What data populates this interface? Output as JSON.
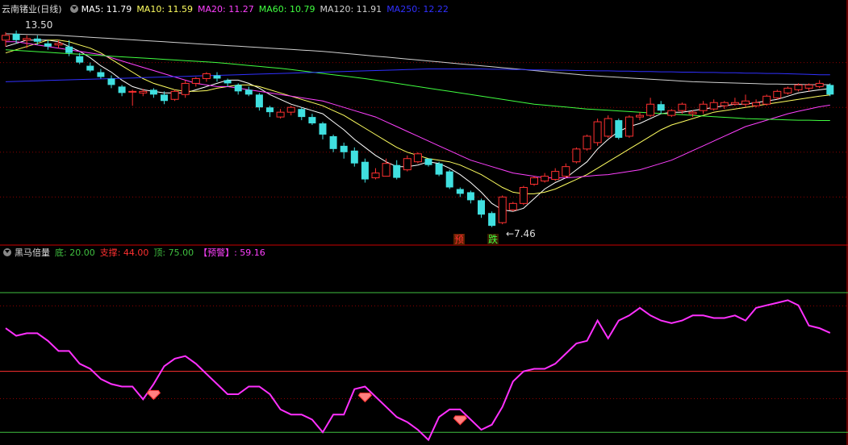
{
  "top_header": {
    "title": "云南锗业(日线)",
    "items": [
      {
        "label": "MA5: 11.79",
        "color": "#ffffff"
      },
      {
        "label": "MA10: 11.59",
        "color": "#ffff60"
      },
      {
        "label": "MA20: 11.27",
        "color": "#ff40ff"
      },
      {
        "label": "MA60: 10.79",
        "color": "#40ff40"
      },
      {
        "label": "MA120: 11.91",
        "color": "#d0d0d0"
      },
      {
        "label": "MA250: 12.22",
        "color": "#3030ff"
      }
    ]
  },
  "bottom_header": {
    "title": "黑马倍量",
    "items": [
      {
        "label": "底: 20.00",
        "color": "#40c040"
      },
      {
        "label": "支撑: 44.00",
        "color": "#ff3030"
      },
      {
        "label": "顶: 75.00",
        "color": "#40c040"
      },
      {
        "label": "【预警】: 59.16",
        "color": "#ff40ff"
      }
    ]
  },
  "annotations": {
    "high_label": "13.50",
    "low_label": "←7.46",
    "signal_pre": "预",
    "signal_drop": "跌"
  },
  "colors": {
    "up": "#ff3030",
    "down": "#40e0e0",
    "grid": "#8b0000",
    "separator": "#cc0000",
    "indicator": "#ff30ff"
  },
  "chart_data": [
    {
      "type": "candlestick",
      "title": "云南锗业(日线)",
      "ylim": [
        7.0,
        14.0
      ],
      "candles": [
        [
          13.3,
          13.55,
          13.1,
          13.45
        ],
        [
          13.5,
          13.6,
          13.2,
          13.3
        ],
        [
          13.3,
          13.45,
          13.05,
          13.35
        ],
        [
          13.35,
          13.45,
          13.15,
          13.25
        ],
        [
          13.2,
          13.3,
          13.0,
          13.1
        ],
        [
          13.15,
          13.3,
          13.05,
          13.2
        ],
        [
          13.1,
          13.3,
          12.8,
          12.9
        ],
        [
          12.8,
          12.9,
          12.55,
          12.6
        ],
        [
          12.5,
          12.6,
          12.3,
          12.35
        ],
        [
          12.3,
          12.4,
          12.1,
          12.15
        ],
        [
          12.1,
          12.2,
          11.8,
          11.9
        ],
        [
          11.85,
          11.9,
          11.55,
          11.65
        ],
        [
          11.7,
          11.75,
          11.25,
          11.7
        ],
        [
          11.65,
          11.78,
          11.55,
          11.7
        ],
        [
          11.75,
          11.8,
          11.5,
          11.6
        ],
        [
          11.6,
          11.7,
          11.3,
          11.4
        ],
        [
          11.45,
          11.75,
          11.4,
          11.7
        ],
        [
          11.6,
          12.05,
          11.5,
          11.95
        ],
        [
          11.95,
          12.15,
          11.85,
          12.1
        ],
        [
          12.1,
          12.3,
          12.0,
          12.25
        ],
        [
          12.2,
          12.3,
          12.0,
          12.1
        ],
        [
          12.05,
          12.1,
          11.85,
          11.95
        ],
        [
          11.9,
          11.95,
          11.6,
          11.7
        ],
        [
          11.75,
          11.85,
          11.55,
          11.6
        ],
        [
          11.6,
          11.65,
          11.1,
          11.2
        ],
        [
          11.2,
          11.25,
          10.9,
          11.05
        ],
        [
          10.9,
          11.15,
          10.85,
          11.05
        ],
        [
          11.05,
          11.25,
          10.95,
          11.2
        ],
        [
          11.15,
          11.2,
          10.8,
          10.9
        ],
        [
          10.9,
          11.0,
          10.65,
          10.7
        ],
        [
          10.7,
          10.75,
          10.2,
          10.35
        ],
        [
          10.3,
          10.35,
          9.8,
          9.9
        ],
        [
          10.0,
          10.1,
          9.6,
          9.8
        ],
        [
          9.85,
          9.95,
          9.35,
          9.45
        ],
        [
          9.5,
          9.6,
          8.85,
          8.95
        ],
        [
          9.0,
          9.3,
          8.95,
          9.15
        ],
        [
          9.05,
          9.6,
          9.05,
          9.45
        ],
        [
          9.4,
          9.55,
          8.95,
          9.0
        ],
        [
          9.25,
          9.7,
          9.2,
          9.6
        ],
        [
          9.5,
          9.8,
          9.45,
          9.75
        ],
        [
          9.6,
          9.6,
          9.35,
          9.4
        ],
        [
          9.45,
          9.5,
          9.05,
          9.1
        ],
        [
          9.2,
          9.25,
          8.65,
          8.7
        ],
        [
          8.65,
          8.7,
          8.4,
          8.5
        ],
        [
          8.55,
          8.6,
          8.2,
          8.3
        ],
        [
          8.3,
          8.35,
          7.75,
          7.85
        ],
        [
          7.9,
          7.95,
          7.46,
          7.5
        ],
        [
          7.6,
          8.45,
          7.55,
          8.4
        ],
        [
          8.0,
          8.25,
          7.95,
          8.2
        ],
        [
          8.2,
          8.75,
          8.15,
          8.7
        ],
        [
          8.8,
          9.05,
          8.75,
          9.0
        ],
        [
          8.9,
          9.15,
          8.85,
          9.05
        ],
        [
          8.95,
          9.3,
          8.9,
          9.2
        ],
        [
          9.05,
          9.45,
          9.0,
          9.35
        ],
        [
          9.5,
          9.95,
          9.45,
          9.9
        ],
        [
          9.9,
          10.35,
          9.85,
          10.3
        ],
        [
          10.1,
          10.85,
          10.0,
          10.75
        ],
        [
          10.3,
          10.95,
          10.25,
          10.85
        ],
        [
          10.8,
          10.85,
          10.2,
          10.25
        ],
        [
          10.3,
          10.95,
          10.25,
          10.9
        ],
        [
          10.9,
          11.05,
          10.8,
          10.95
        ],
        [
          10.95,
          11.5,
          10.9,
          11.3
        ],
        [
          11.3,
          11.4,
          11.0,
          11.1
        ],
        [
          10.95,
          11.15,
          10.9,
          11.1
        ],
        [
          11.1,
          11.35,
          11.0,
          11.3
        ],
        [
          11.0,
          11.1,
          10.9,
          11.05
        ],
        [
          11.1,
          11.4,
          11.0,
          11.3
        ],
        [
          11.15,
          11.45,
          11.1,
          11.35
        ],
        [
          11.25,
          11.4,
          11.15,
          11.35
        ],
        [
          11.3,
          11.5,
          11.25,
          11.35
        ],
        [
          11.3,
          11.6,
          11.2,
          11.4
        ],
        [
          11.25,
          11.45,
          11.2,
          11.35
        ],
        [
          11.3,
          11.6,
          11.25,
          11.55
        ],
        [
          11.5,
          11.75,
          11.45,
          11.7
        ],
        [
          11.65,
          11.85,
          11.6,
          11.8
        ],
        [
          11.75,
          11.95,
          11.7,
          11.9
        ],
        [
          11.8,
          11.95,
          11.7,
          11.9
        ],
        [
          11.85,
          12.05,
          11.8,
          11.95
        ],
        [
          11.9,
          11.95,
          11.55,
          11.6
        ]
      ],
      "series": [
        {
          "name": "MA5",
          "values": [
            13.1,
            13.2,
            13.3,
            13.3,
            13.3,
            13.25,
            13.1,
            12.95,
            12.75,
            12.5,
            12.3,
            12.05,
            11.85,
            11.75,
            11.7,
            11.65,
            11.65,
            11.65,
            11.75,
            11.85,
            11.95,
            12.05,
            12.05,
            11.95,
            11.8,
            11.6,
            11.45,
            11.3,
            11.2,
            11.1,
            11.0,
            10.75,
            10.5,
            10.2,
            9.95,
            9.7,
            9.5,
            9.35,
            9.35,
            9.4,
            9.5,
            9.45,
            9.3,
            9.1,
            8.85,
            8.55,
            8.2,
            8.0,
            7.95,
            8.05,
            8.35,
            8.65,
            8.85,
            9.0,
            9.25,
            9.5,
            9.9,
            10.2,
            10.45,
            10.6,
            10.7,
            10.85,
            11.0,
            11.05,
            11.05,
            11.1,
            11.15,
            11.2,
            11.25,
            11.3,
            11.3,
            11.35,
            11.4,
            11.45,
            11.55,
            11.65,
            11.7,
            11.75,
            11.79
          ]
        },
        {
          "name": "MA10",
          "values": [
            12.9,
            13.0,
            13.1,
            13.2,
            13.3,
            13.3,
            13.25,
            13.15,
            13.05,
            12.9,
            12.7,
            12.5,
            12.3,
            12.1,
            11.95,
            11.85,
            11.75,
            11.7,
            11.7,
            11.72,
            11.8,
            11.85,
            11.9,
            11.9,
            11.85,
            11.75,
            11.65,
            11.55,
            11.45,
            11.35,
            11.25,
            11.1,
            10.95,
            10.75,
            10.55,
            10.35,
            10.15,
            9.95,
            9.8,
            9.7,
            9.6,
            9.55,
            9.5,
            9.4,
            9.25,
            9.1,
            8.9,
            8.7,
            8.55,
            8.5,
            8.5,
            8.55,
            8.65,
            8.8,
            8.95,
            9.1,
            9.3,
            9.5,
            9.7,
            9.9,
            10.1,
            10.3,
            10.5,
            10.65,
            10.75,
            10.85,
            10.95,
            11.05,
            11.1,
            11.15,
            11.2,
            11.25,
            11.3,
            11.35,
            11.4,
            11.45,
            11.5,
            11.55,
            11.59
          ]
        },
        {
          "name": "MA20",
          "values": [
            13.25,
            13.25,
            13.2,
            13.15,
            13.1,
            13.05,
            13.0,
            12.95,
            12.9,
            12.85,
            12.75,
            12.65,
            12.55,
            12.45,
            12.35,
            12.25,
            12.15,
            12.05,
            11.95,
            11.9,
            11.85,
            11.85,
            11.8,
            11.75,
            11.7,
            11.65,
            11.6,
            11.55,
            11.5,
            11.45,
            11.4,
            11.3,
            11.2,
            11.1,
            11.0,
            10.9,
            10.75,
            10.6,
            10.45,
            10.3,
            10.15,
            10.0,
            9.85,
            9.7,
            9.55,
            9.45,
            9.35,
            9.25,
            9.15,
            9.1,
            9.05,
            9.0,
            9.0,
            9.0,
            9.02,
            9.05,
            9.08,
            9.1,
            9.15,
            9.2,
            9.25,
            9.35,
            9.45,
            9.55,
            9.7,
            9.85,
            10.0,
            10.15,
            10.3,
            10.45,
            10.6,
            10.7,
            10.8,
            10.9,
            11.0,
            11.08,
            11.15,
            11.22,
            11.27
          ]
        },
        {
          "name": "MA60",
          "values": [
            13.0,
            12.98,
            12.96,
            12.94,
            12.92,
            12.9,
            12.88,
            12.86,
            12.84,
            12.82,
            12.8,
            12.78,
            12.76,
            12.74,
            12.72,
            12.7,
            12.68,
            12.66,
            12.64,
            12.62,
            12.6,
            12.57,
            12.54,
            12.51,
            12.48,
            12.45,
            12.42,
            12.38,
            12.34,
            12.3,
            12.26,
            12.22,
            12.18,
            12.14,
            12.1,
            12.05,
            12.0,
            11.95,
            11.9,
            11.85,
            11.8,
            11.75,
            11.7,
            11.65,
            11.6,
            11.55,
            11.5,
            11.45,
            11.4,
            11.35,
            11.3,
            11.27,
            11.24,
            11.21,
            11.18,
            11.15,
            11.13,
            11.11,
            11.09,
            11.07,
            11.05,
            11.03,
            11.01,
            10.99,
            10.97,
            10.95,
            10.93,
            10.91,
            10.89,
            10.87,
            10.85,
            10.84,
            10.83,
            10.82,
            10.81,
            10.8,
            10.8,
            10.79,
            10.79
          ]
        },
        {
          "name": "MA120",
          "values": [
            13.5,
            13.49,
            13.48,
            13.47,
            13.46,
            13.45,
            13.43,
            13.41,
            13.39,
            13.37,
            13.35,
            13.33,
            13.31,
            13.29,
            13.27,
            13.25,
            13.23,
            13.21,
            13.19,
            13.17,
            13.15,
            13.13,
            13.11,
            13.09,
            13.07,
            13.05,
            13.03,
            13.01,
            12.99,
            12.97,
            12.95,
            12.92,
            12.89,
            12.86,
            12.83,
            12.8,
            12.77,
            12.74,
            12.71,
            12.68,
            12.65,
            12.62,
            12.59,
            12.56,
            12.53,
            12.5,
            12.47,
            12.44,
            12.41,
            12.38,
            12.35,
            12.32,
            12.29,
            12.26,
            12.23,
            12.2,
            12.18,
            12.16,
            12.14,
            12.12,
            12.1,
            12.08,
            12.06,
            12.04,
            12.02,
            12.0,
            11.99,
            11.98,
            11.97,
            11.96,
            11.95,
            11.94,
            11.93,
            11.93,
            11.92,
            11.92,
            11.91,
            11.91,
            11.91
          ]
        },
        {
          "name": "MA250",
          "values": [
            12.0,
            12.01,
            12.02,
            12.03,
            12.04,
            12.05,
            12.06,
            12.07,
            12.08,
            12.09,
            12.1,
            12.11,
            12.12,
            12.13,
            12.14,
            12.15,
            12.16,
            12.17,
            12.18,
            12.19,
            12.2,
            12.21,
            12.22,
            12.23,
            12.24,
            12.25,
            12.26,
            12.27,
            12.28,
            12.29,
            12.3,
            12.31,
            12.32,
            12.33,
            12.34,
            12.35,
            12.36,
            12.37,
            12.38,
            12.39,
            12.4,
            12.4,
            12.4,
            12.4,
            12.4,
            12.4,
            12.39,
            12.39,
            12.38,
            12.38,
            12.37,
            12.37,
            12.36,
            12.36,
            12.35,
            12.35,
            12.34,
            12.34,
            12.33,
            12.33,
            12.32,
            12.32,
            12.31,
            12.31,
            12.3,
            12.3,
            12.29,
            12.29,
            12.28,
            12.28,
            12.27,
            12.27,
            12.26,
            12.26,
            12.25,
            12.24,
            12.23,
            12.22,
            12.22
          ]
        }
      ],
      "signals": [
        {
          "index": 43,
          "label": "预"
        },
        {
          "index": 46,
          "label": "跌"
        }
      ]
    },
    {
      "type": "line",
      "title": "黑马倍量",
      "ylim": [
        15,
        88
      ],
      "levels": [
        {
          "name": "底",
          "value": 20
        },
        {
          "name": "支撑",
          "value": 44
        },
        {
          "name": "顶",
          "value": 75
        }
      ],
      "series": [
        {
          "name": "预警",
          "values": [
            61,
            58,
            59,
            59,
            56,
            52,
            52,
            47,
            45,
            41,
            39,
            38,
            38,
            33,
            39,
            46,
            49,
            50,
            47,
            43,
            39,
            35,
            35,
            38,
            38,
            35,
            29,
            27,
            27,
            25,
            20,
            27,
            27,
            37,
            38,
            34,
            30,
            26,
            24,
            21,
            17,
            26,
            29,
            29,
            25,
            21,
            23,
            30,
            40,
            44,
            45,
            45,
            47,
            51,
            55,
            56,
            64,
            57,
            64,
            66,
            69,
            66,
            64,
            63,
            64,
            66,
            66,
            65,
            65,
            66,
            64,
            69,
            70,
            71,
            72,
            70,
            62,
            61,
            59.16
          ]
        }
      ],
      "markers": [
        {
          "index": 14,
          "type": "diamond"
        },
        {
          "index": 34,
          "type": "diamond"
        },
        {
          "index": 43,
          "type": "diamond"
        }
      ]
    }
  ]
}
